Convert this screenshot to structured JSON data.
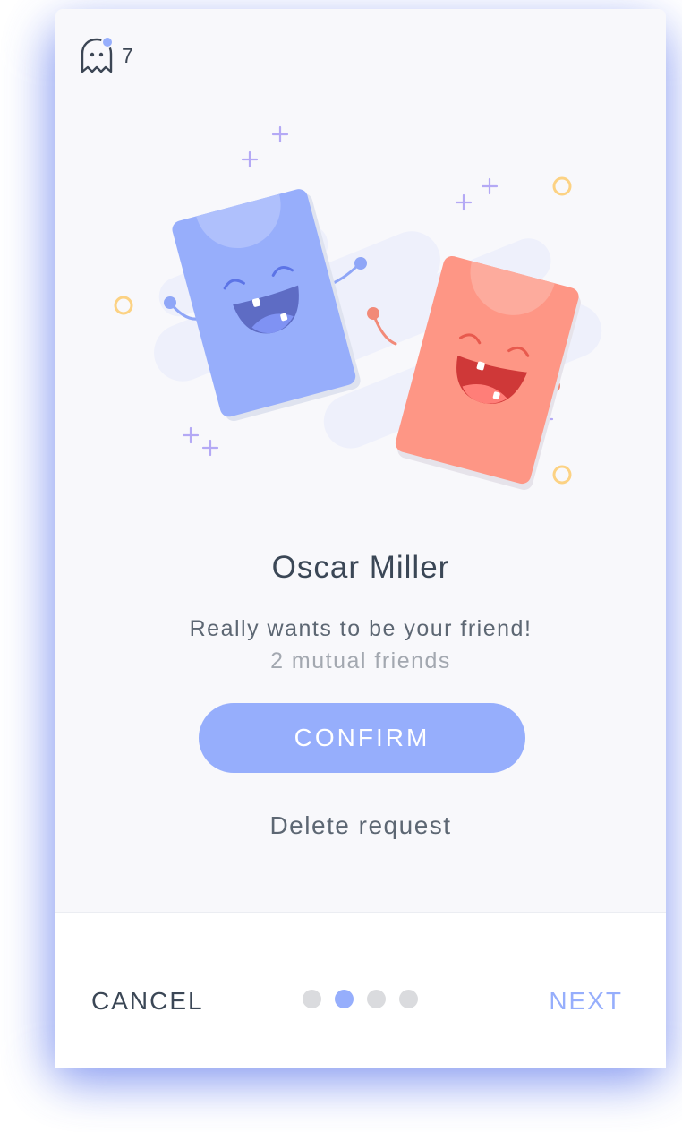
{
  "notification": {
    "icon": "ghost-icon",
    "count": "7",
    "badge_color": "#96aefc"
  },
  "illustration": {
    "subject": "two-happy-phones-high-five",
    "blue_phone_color": "#97aefb",
    "red_phone_color": "#fe9685"
  },
  "profile": {
    "name": "Oscar Miller",
    "message": "Really wants to be your friend!",
    "mutual": "2 mutual friends"
  },
  "actions": {
    "confirm_label": "CONFIRM",
    "delete_label": "Delete request"
  },
  "footer": {
    "cancel_label": "CANCEL",
    "next_label": "NEXT",
    "pages": 4,
    "active_page": 2
  },
  "colors": {
    "accent": "#96aefc",
    "text_dark": "#3b4756",
    "text_muted": "#a3a8b0",
    "background": "#f8f8fb"
  }
}
